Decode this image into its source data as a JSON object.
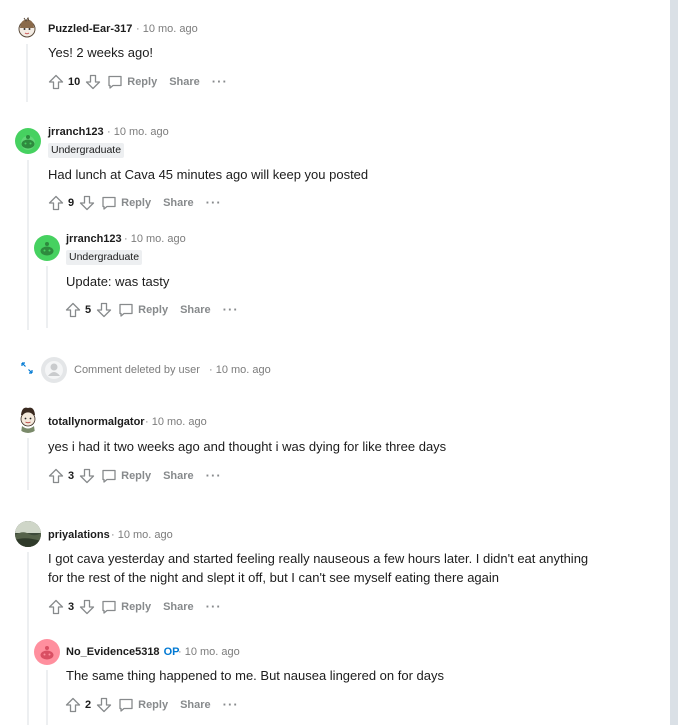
{
  "comments": [
    {
      "author": "Puzzled-Ear-317",
      "time": "· 10 mo. ago",
      "text": "Yes! 2 weeks ago!",
      "votes": "10",
      "reply_label": "Reply",
      "share_label": "Share"
    },
    {
      "author": "jrranch123",
      "time": "· 10 mo. ago",
      "flair": "Undergraduate",
      "text": "Had lunch at Cava 45 minutes ago will keep you posted",
      "votes": "9",
      "reply_label": "Reply",
      "share_label": "Share"
    },
    {
      "author": "jrranch123",
      "time": "· 10 mo. ago",
      "flair": "Undergraduate",
      "text": "Update: was tasty",
      "votes": "5",
      "reply_label": "Reply",
      "share_label": "Share"
    },
    {
      "deleted_text": "Comment deleted by user",
      "time": "· 10 mo. ago"
    },
    {
      "author": "totallynormalgator",
      "time": "· 10 mo. ago",
      "text": "yes i had it two weeks ago and thought i was dying for like three days",
      "votes": "3",
      "reply_label": "Reply",
      "share_label": "Share"
    },
    {
      "author": "priyalations",
      "time": "· 10 mo. ago",
      "text_line1": "I got cava yesterday and started feeling really nauseous a few hours later. I didn't eat anything",
      "text_line2": "for the rest of the night and slept it off, but I can't see myself eating there again",
      "votes": "3",
      "reply_label": "Reply",
      "share_label": "Share"
    },
    {
      "author": "No_Evidence5318",
      "op_badge": "OP",
      "time": "· 10 mo. ago",
      "text": "The same thing happened to me. But nausea lingered on for days",
      "votes": "2",
      "reply_label": "Reply",
      "share_label": "Share"
    }
  ],
  "colors": {
    "meta": "#7c7c7c",
    "action": "#878a8c",
    "op": "#0079d3",
    "thread_line": "#edeff1"
  },
  "icons": {
    "upvote": "upvote-arrow-icon",
    "downvote": "downvote-arrow-icon",
    "reply": "comment-bubble-icon",
    "more": "more-options-icon",
    "expand": "expand-arrows-icon"
  }
}
